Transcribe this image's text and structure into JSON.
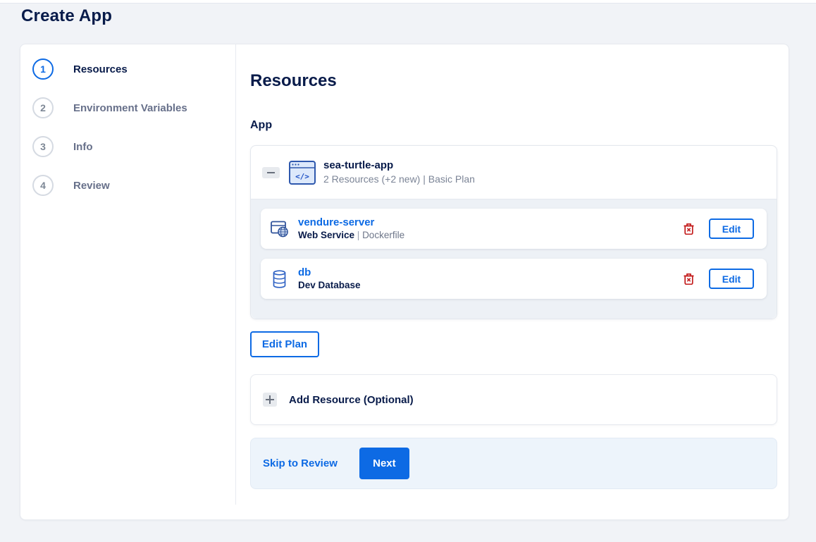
{
  "page": {
    "title": "Create App"
  },
  "colors": {
    "accent_blue": "#0d6ae4",
    "navy_text": "#081b4a",
    "muted_text": "#7b8496",
    "danger_red": "#c31b1b",
    "page_bg": "#f1f3f7",
    "group_body_bg": "#edf1f6",
    "footer_bg": "#edf4fb"
  },
  "stepper": {
    "items": [
      {
        "number": "1",
        "label": "Resources",
        "active": true
      },
      {
        "number": "2",
        "label": "Environment Variables",
        "active": false
      },
      {
        "number": "3",
        "label": "Info",
        "active": false
      },
      {
        "number": "4",
        "label": "Review",
        "active": false
      }
    ]
  },
  "content": {
    "heading": "Resources",
    "section_label": "App",
    "app_group": {
      "name": "sea-turtle-app",
      "meta": "2 Resources (+2 new) | Basic Plan",
      "icons": {
        "app": "code-window-icon",
        "collapse": "minus-icon"
      },
      "resources": [
        {
          "name": "vendure-server",
          "type": "Web Service",
          "detail": "Dockerfile",
          "icon": "web-service-globe-icon"
        },
        {
          "name": "db",
          "type": "Dev Database",
          "icon": "database-cylinder-icon"
        }
      ]
    },
    "labels": {
      "edit": "Edit",
      "edit_plan": "Edit Plan",
      "add_resource": "Add Resource (Optional)"
    },
    "footer": {
      "skip_label": "Skip to Review",
      "next_label": "Next"
    }
  }
}
